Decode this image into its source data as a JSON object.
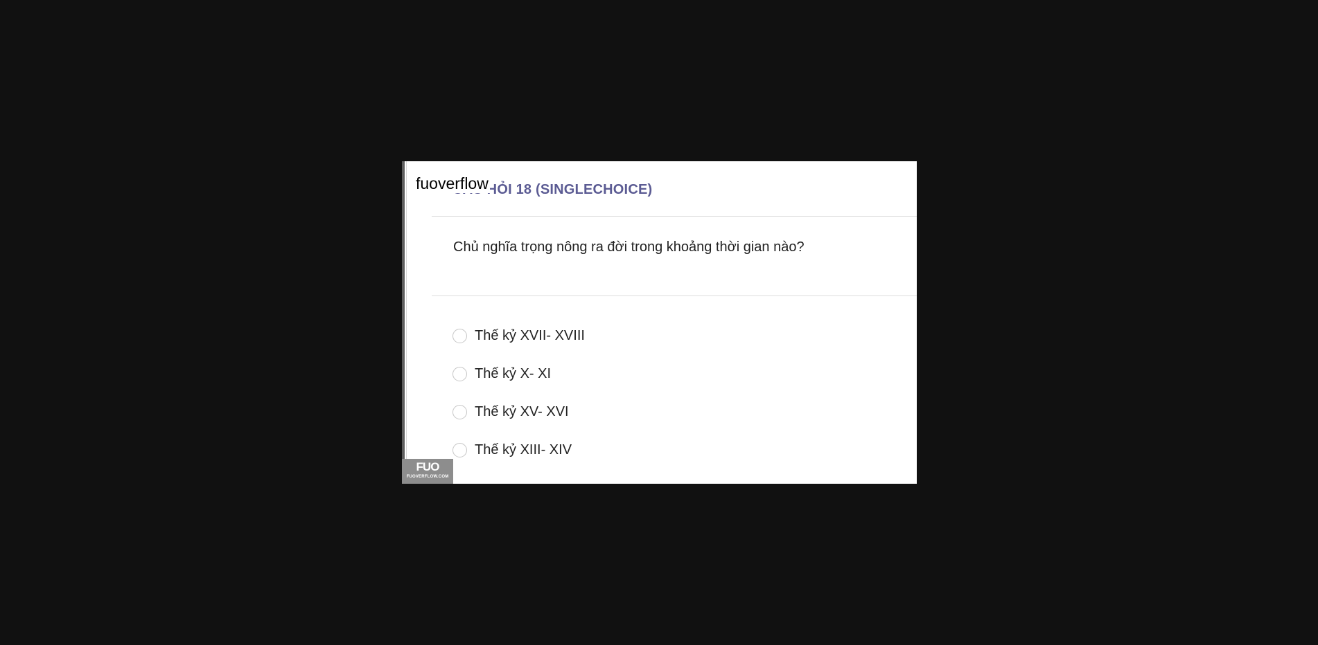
{
  "watermark": {
    "text": "fuoverflow",
    "badge_logo": "FUO",
    "badge_domain": "FUOVERFLOW.COM"
  },
  "question": {
    "heading": "CÂU HỎI 18 (SINGLECHOICE)",
    "text": "Chủ nghĩa trọng nông ra đời trong khoảng thời gian nào?",
    "options": [
      {
        "label": "Thế kỷ XVII- XVIII",
        "selected": false
      },
      {
        "label": "Thế kỷ X- XI",
        "selected": false
      },
      {
        "label": "Thế kỷ XV- XVI",
        "selected": false
      },
      {
        "label": "Thế kỷ XIII- XIV",
        "selected": false
      }
    ]
  },
  "colors": {
    "backdrop": "#111111",
    "panel": "#ffffff",
    "heading": "#5b5b93",
    "text": "#222222",
    "badge": "#8d8d8d"
  }
}
